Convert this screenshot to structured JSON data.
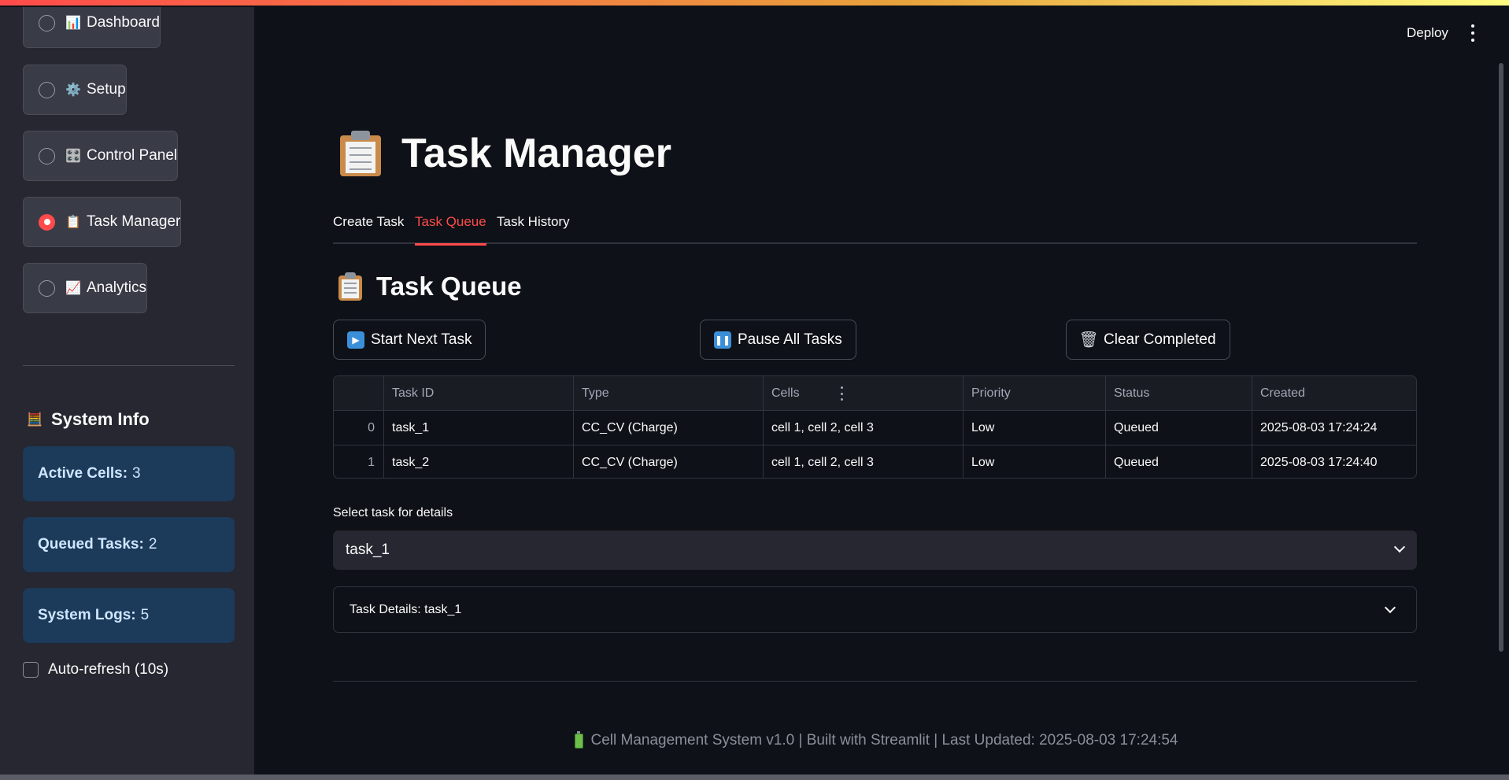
{
  "header": {
    "deploy_label": "Deploy"
  },
  "sidebar": {
    "nav": [
      {
        "emoji": "📊",
        "label": "Dashboard",
        "selected": false
      },
      {
        "emoji": "⚙️",
        "label": "Setup",
        "selected": false
      },
      {
        "emoji": "🎛️",
        "label": "Control Panel",
        "selected": false
      },
      {
        "emoji": "📋",
        "label": "Task Manager",
        "selected": true
      },
      {
        "emoji": "📈",
        "label": "Analytics",
        "selected": false
      }
    ],
    "system_info": {
      "emoji": "🧮",
      "title": "System Info",
      "active_cells_label": "Active Cells:",
      "active_cells_value": "3",
      "queued_tasks_label": "Queued Tasks:",
      "queued_tasks_value": "2",
      "system_logs_label": "System Logs:",
      "system_logs_value": "5"
    },
    "auto_refresh_label": "Auto-refresh (10s)",
    "auto_refresh_checked": false
  },
  "main": {
    "title": "Task Manager",
    "tabs": [
      "Create Task",
      "Task Queue",
      "Task History"
    ],
    "active_tab": "Task Queue",
    "section_title": "Task Queue",
    "buttons": {
      "start_next": "Start Next Task",
      "pause_all": "Pause All Tasks",
      "clear_completed": "Clear Completed"
    },
    "table": {
      "columns": [
        "",
        "Task ID",
        "Type",
        "Cells",
        "Priority",
        "Status",
        "Created"
      ],
      "rows": [
        [
          "0",
          "task_1",
          "CC_CV (Charge)",
          "cell 1, cell 2, cell 3",
          "Low",
          "Queued",
          "2025-08-03 17:24:24"
        ],
        [
          "1",
          "task_2",
          "CC_CV (Charge)",
          "cell 1, cell 2, cell 3",
          "Low",
          "Queued",
          "2025-08-03 17:24:40"
        ]
      ]
    },
    "select_label": "Select task for details",
    "select_value": "task_1",
    "expander_label": "Task Details: task_1"
  },
  "footer": {
    "text": "Cell Management System v1.0 | Built with Streamlit | Last Updated: 2025-08-03 17:24:54"
  },
  "colors": {
    "accent": "#ff4b4b",
    "info_card": "#1c3a5a",
    "sidebar_bg": "#262730",
    "main_bg": "#0e1117"
  }
}
